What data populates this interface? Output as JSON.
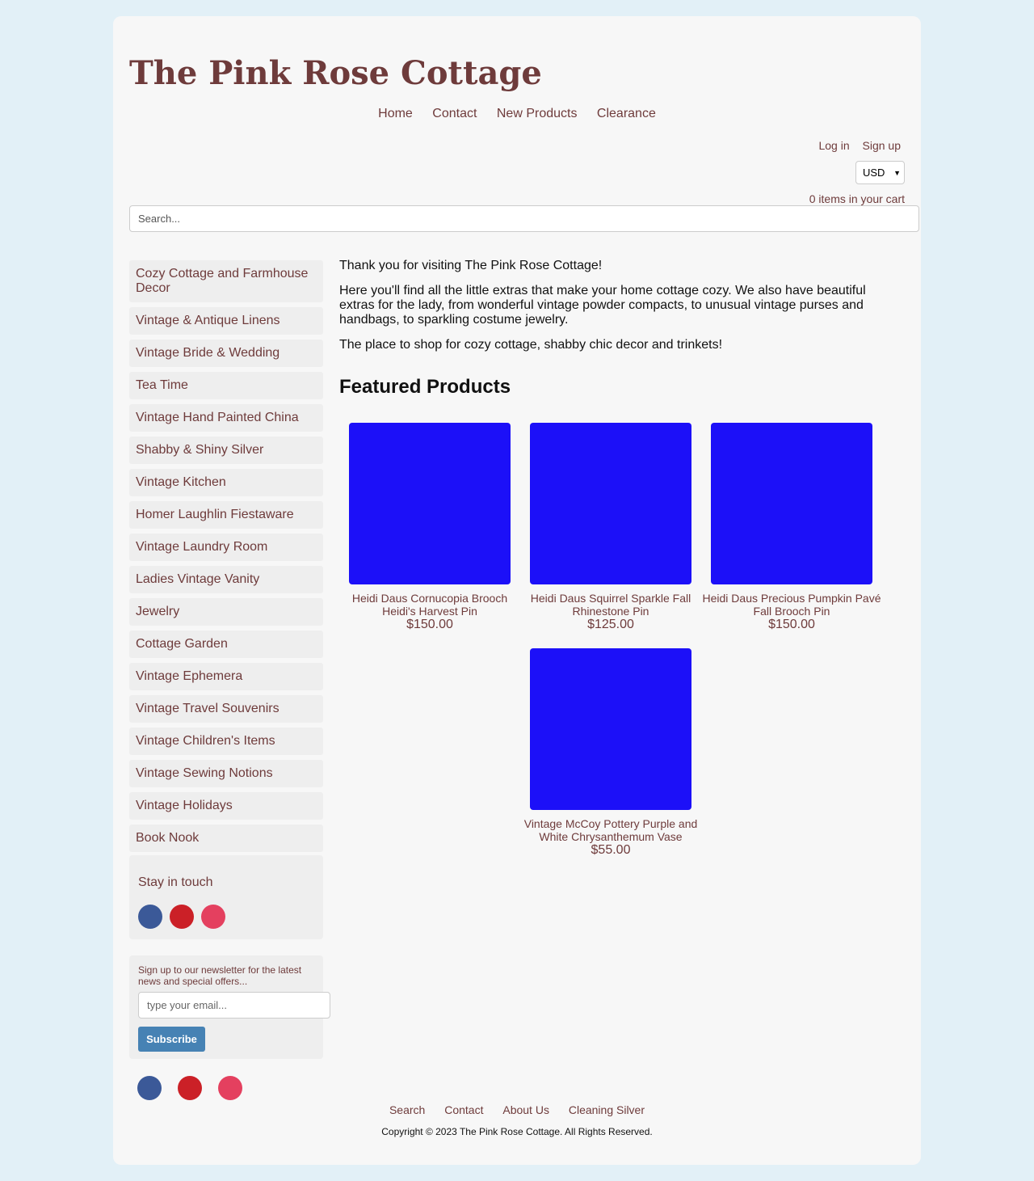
{
  "site": {
    "title": "The Pink Rose Cottage"
  },
  "nav": [
    "Home",
    "Contact",
    "New Products",
    "Clearance"
  ],
  "account": {
    "login": "Log in",
    "signup": "Sign up"
  },
  "currency": {
    "selected": "USD"
  },
  "cart": {
    "text": "0 items in your cart"
  },
  "search": {
    "placeholder": "Search..."
  },
  "categories": [
    "Cozy Cottage and Farmhouse Decor",
    "Vintage & Antique Linens",
    "Vintage Bride & Wedding",
    "Tea Time",
    "Vintage Hand Painted China",
    "Shabby & Shiny Silver",
    "Vintage Kitchen",
    "Homer Laughlin Fiestaware",
    "Vintage Laundry Room",
    "Ladies Vintage Vanity",
    "Jewelry",
    "Cottage Garden",
    "Vintage Ephemera",
    "Vintage Travel Souvenirs",
    "Vintage Children's Items",
    "Vintage Sewing Notions",
    "Vintage Holidays",
    "Book Nook"
  ],
  "stay_in_touch": {
    "title": "Stay in touch",
    "icons": [
      "facebook-icon",
      "pinterest-icon",
      "instagram-icon"
    ]
  },
  "newsletter": {
    "text": "Sign up to our newsletter for the latest news and special offers...",
    "placeholder": "type your email...",
    "button": "Subscribe"
  },
  "intro": [
    "Thank you for visiting The Pink Rose Cottage!",
    "Here you'll find all the little extras that make your home cottage cozy. We also have beautiful extras for the lady, from wonderful vintage powder compacts, to unusual vintage purses and handbags, to sparkling costume jewelry.",
    "The place to shop for cozy cottage, shabby chic decor and trinkets!"
  ],
  "featured": {
    "title": "Featured Products",
    "products": [
      {
        "name": "Heidi Daus Cornucopia Brooch Heidi's Harvest Pin",
        "price": "$150.00"
      },
      {
        "name": "Heidi Daus Squirrel Sparkle Fall Rhinestone Pin",
        "price": "$125.00"
      },
      {
        "name": "Heidi Daus Precious Pumpkin Pavé Fall Brooch Pin",
        "price": "$150.00"
      },
      {
        "name": "Vintage McCoy Pottery Purple and White Chrysanthemum Vase",
        "price": "$55.00"
      }
    ]
  },
  "footer": {
    "links": [
      "Search",
      "Contact",
      "About Us",
      "Cleaning Silver"
    ],
    "copyright": "Copyright © 2023 The Pink Rose Cottage. All Rights Reserved."
  },
  "colors": {
    "brand": "#6e3b3b",
    "background": "#e2f0f7",
    "product_image": "#1c10f8",
    "button": "#4682b4"
  }
}
